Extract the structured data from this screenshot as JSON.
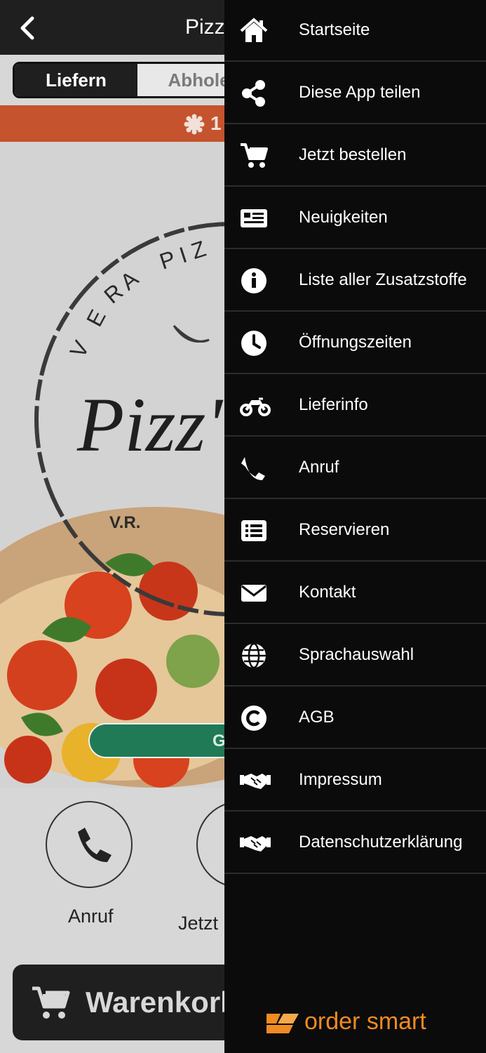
{
  "app": {
    "title": "Pizz",
    "tabs": [
      {
        "label": "Liefern",
        "active": true
      },
      {
        "label": "Abhole",
        "active": false
      }
    ],
    "promo_text": "1",
    "logo": {
      "ring_text": "VERA PIZ",
      "script_text": "Pizz'",
      "initials": "V.R."
    },
    "hero_button_label": "G",
    "actions": [
      {
        "label": "Anruf",
        "icon": "phone-icon"
      },
      {
        "label": "Jetzt",
        "icon": "cart-icon"
      }
    ],
    "cart_label": "Warenkorb"
  },
  "drawer": {
    "items": [
      {
        "label": "Startseite",
        "icon": "home-icon"
      },
      {
        "label": "Diese App teilen",
        "icon": "share-icon"
      },
      {
        "label": "Jetzt bestellen",
        "icon": "cart-icon"
      },
      {
        "label": "Neuigkeiten",
        "icon": "news-icon"
      },
      {
        "label": "Liste aller Zusatzstoffe",
        "icon": "info-icon"
      },
      {
        "label": "Öffnungszeiten",
        "icon": "clock-icon"
      },
      {
        "label": "Lieferinfo",
        "icon": "motorcycle-icon"
      },
      {
        "label": "Anruf",
        "icon": "phone-icon"
      },
      {
        "label": "Reservieren",
        "icon": "list-icon"
      },
      {
        "label": "Kontakt",
        "icon": "envelope-icon"
      },
      {
        "label": "Sprachauswahl",
        "icon": "globe-icon"
      },
      {
        "label": "AGB",
        "icon": "copyright-icon"
      },
      {
        "label": "Impressum",
        "icon": "handshake-icon"
      },
      {
        "label": "Datenschutzerklärung",
        "icon": "handshake-icon"
      }
    ],
    "brand": "order smart"
  },
  "colors": {
    "drawer_bg": "#0b0b0b",
    "promo": "#c4532e",
    "brand": "#f08a22",
    "hero_button": "#1f7a55"
  }
}
